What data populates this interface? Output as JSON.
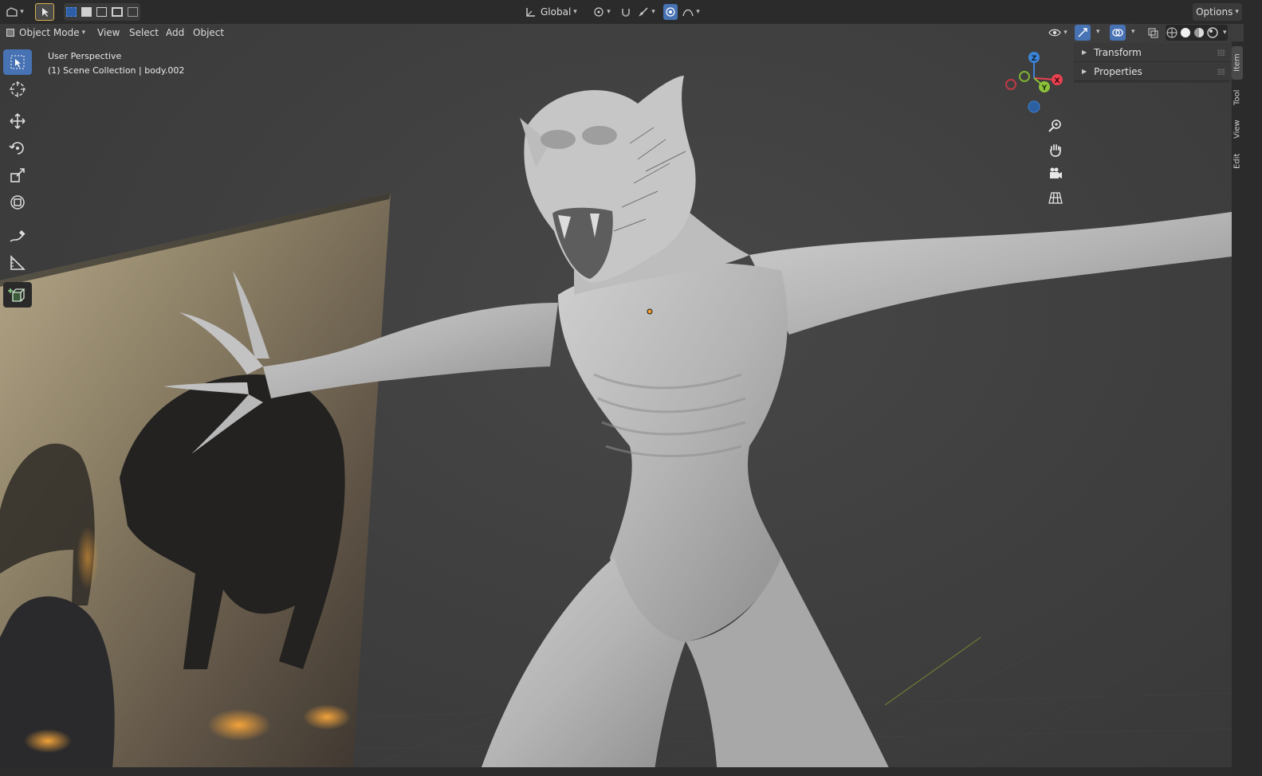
{
  "header": {
    "orientation_label": "Global",
    "options_label": "Options"
  },
  "view_header": {
    "mode_label": "Object Mode",
    "menus": [
      "View",
      "Select",
      "Add",
      "Object"
    ]
  },
  "viewport": {
    "perspective_label": "User Perspective",
    "collection_label": "(1) Scene Collection | body.002"
  },
  "gizmo": {
    "axes": [
      "Z",
      "X",
      "Y"
    ],
    "colors": {
      "x": "#e8414f",
      "y": "#8bc23a",
      "z": "#3b84d8"
    }
  },
  "npanel": {
    "panels": [
      "Transform",
      "Properties"
    ]
  },
  "side_tabs": [
    "Item",
    "Tool",
    "View",
    "Edit"
  ],
  "toolbar": {
    "tools": [
      "select-box",
      "cursor",
      "move",
      "rotate",
      "scale",
      "transform",
      "annotate",
      "measure",
      "add-cube"
    ]
  },
  "colors": {
    "accent": "#4772b3",
    "header_bg": "#2b2b2b",
    "viewport_bg": "#3d3d3d"
  }
}
